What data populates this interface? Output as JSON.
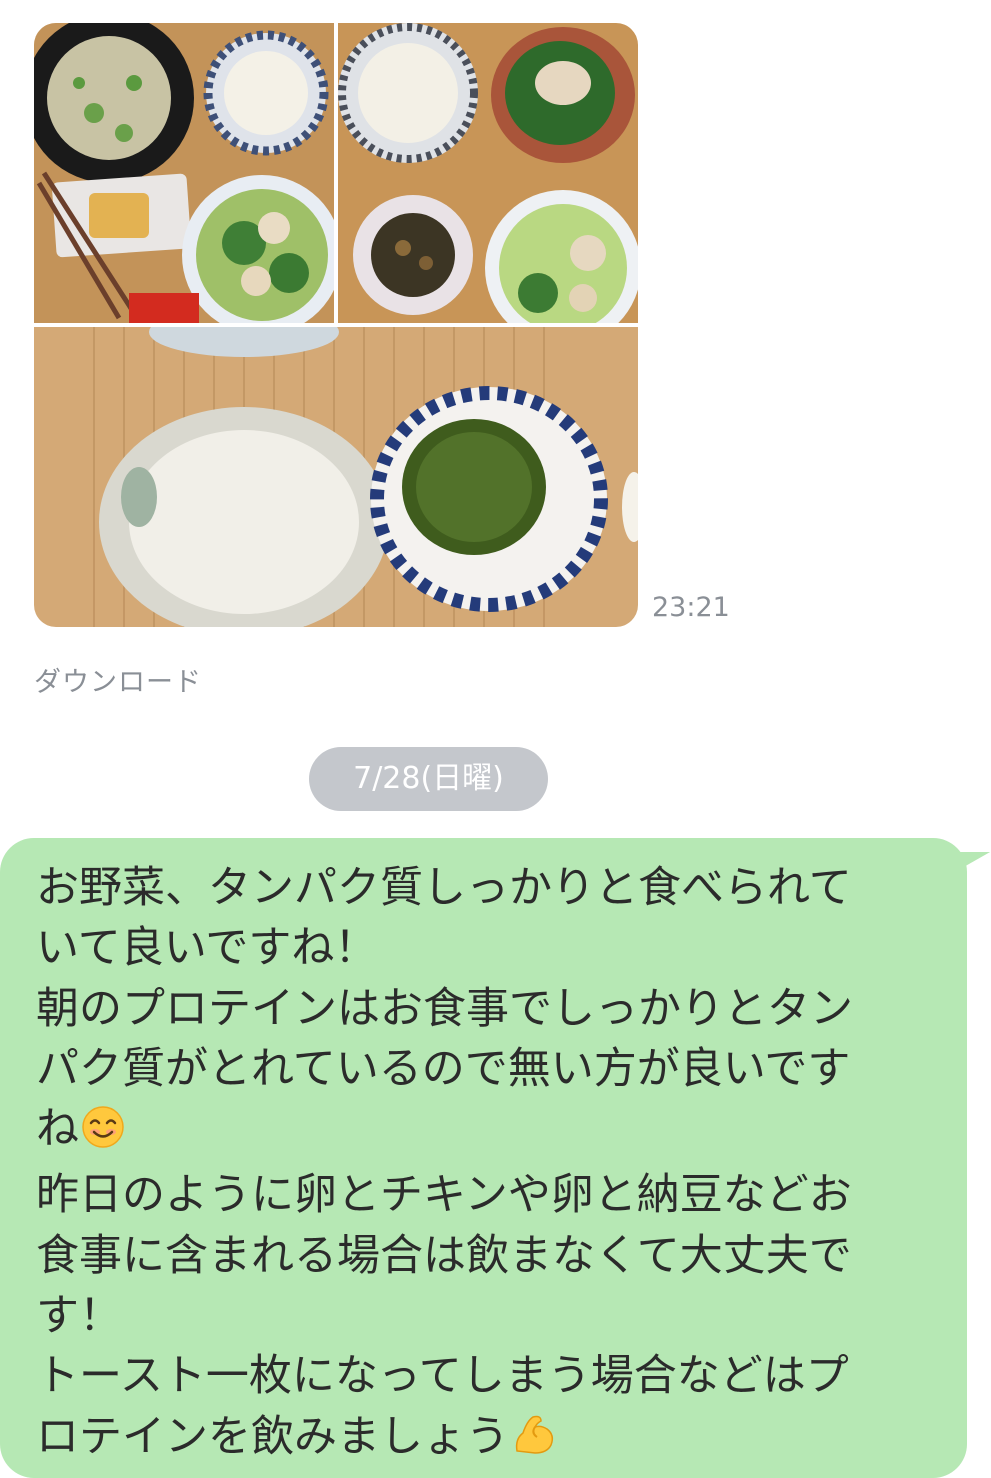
{
  "chat": {
    "image_message": {
      "time": "23:21",
      "download_label": "ダウンロード",
      "photos": [
        "photo-1",
        "photo-2",
        "photo-3"
      ]
    },
    "date_separator": "7/28(日曜)",
    "reply": {
      "lines": [
        "お野菜、タンパク質しっかりと食べられて",
        "いて良いですね！",
        "朝のプロテインはお食事でしっかりとタン",
        "パク質がとれているので無い方が良いです",
        "ね",
        "昨日のように卵とチキンや卵と納豆などお",
        "食事に含まれる場合は飲まなくて大丈夫で",
        "す！",
        "トースト一枚になってしまう場合などはプ",
        "ロテインを飲みましょう"
      ],
      "emojis": [
        "smiling-face-icon",
        "flexed-biceps-icon"
      ]
    }
  },
  "colors": {
    "bubble": "#b6e8b4",
    "date_pill": "#c4c7cc",
    "meta_text": "#8a8f96"
  }
}
